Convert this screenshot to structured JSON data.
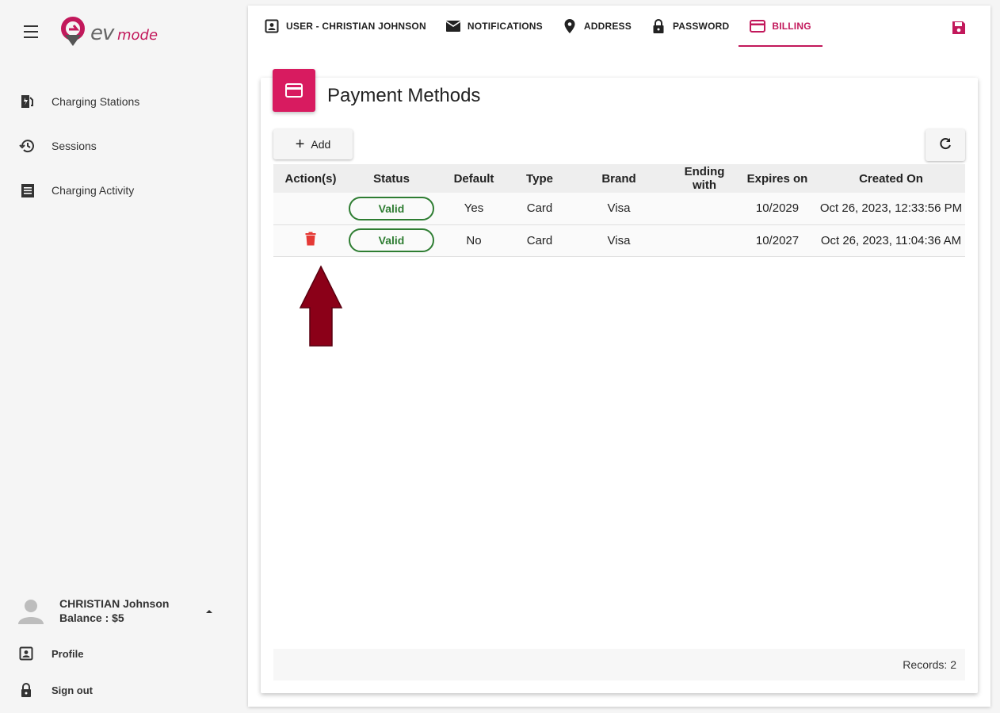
{
  "app": {
    "logo_text": "EVmode",
    "accent_color": "#c2185b",
    "status_color": "#2e7d32"
  },
  "sidebar": {
    "items": [
      {
        "label": "Charging Stations",
        "icon": "ev-station-icon"
      },
      {
        "label": "Sessions",
        "icon": "history-icon"
      },
      {
        "label": "Charging Activity",
        "icon": "receipt-icon"
      }
    ],
    "user": {
      "name": "CHRISTIAN Johnson",
      "balance": "Balance : $5"
    },
    "profile_label": "Profile",
    "signout_label": "Sign out"
  },
  "tabs": [
    {
      "label": "USER - CHRISTIAN JOHNSON",
      "icon": "account-box-icon"
    },
    {
      "label": "NOTIFICATIONS",
      "icon": "mail-icon"
    },
    {
      "label": "ADDRESS",
      "icon": "location-pin-icon"
    },
    {
      "label": "PASSWORD",
      "icon": "lock-icon"
    },
    {
      "label": "BILLING",
      "icon": "credit-card-icon",
      "active": true
    }
  ],
  "card": {
    "title": "Payment Methods",
    "add_label": "Add"
  },
  "table": {
    "columns": [
      "Action(s)",
      "Status",
      "Default",
      "Type",
      "Brand",
      "Ending with",
      "Expires on",
      "Created On"
    ],
    "rows": [
      {
        "action": "",
        "status": "Valid",
        "default": "Yes",
        "type": "Card",
        "brand": "Visa",
        "ending": "",
        "expires": "10/2029",
        "created": "Oct 26, 2023, 12:33:56 PM"
      },
      {
        "action": "delete",
        "status": "Valid",
        "default": "No",
        "type": "Card",
        "brand": "Visa",
        "ending": "",
        "expires": "10/2027",
        "created": "Oct 26, 2023, 11:04:36 AM"
      }
    ]
  },
  "footer": {
    "records": "Records: 2"
  }
}
